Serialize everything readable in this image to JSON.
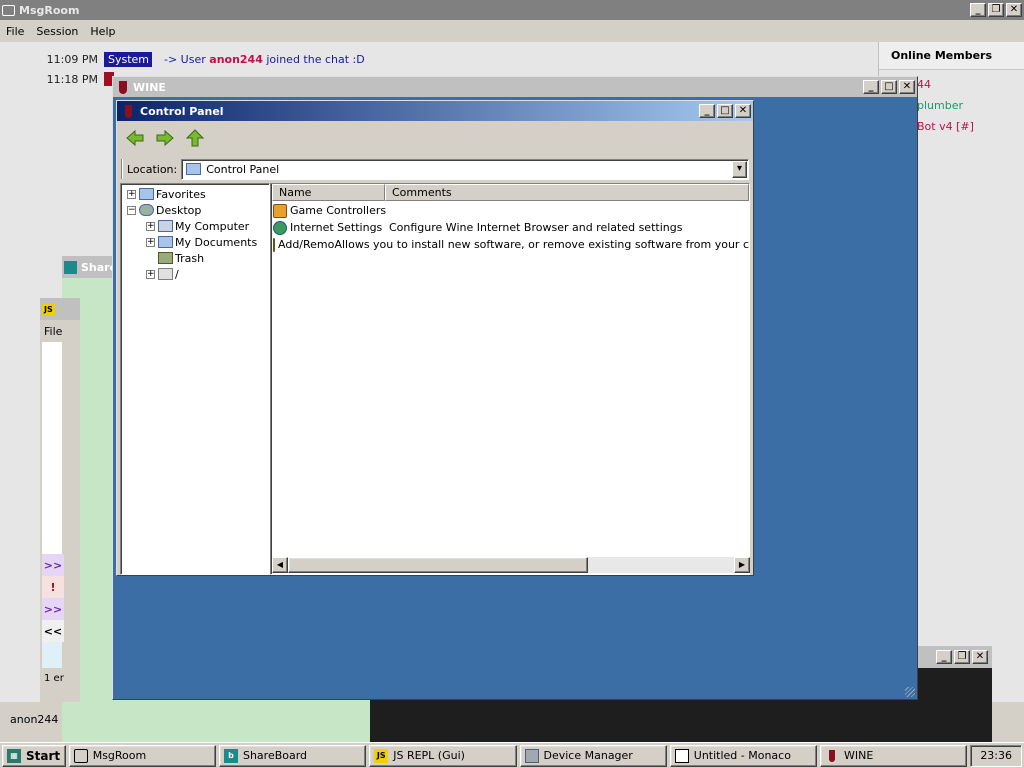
{
  "msgroom": {
    "title": "MsgRoom",
    "menu": [
      "File",
      "Session",
      "Help"
    ],
    "messages": [
      {
        "time": "11:09 PM",
        "sender": "System",
        "pre": "-> User ",
        "user": "anon244",
        "post": " joined the chat :D"
      },
      {
        "time": "11:18 PM"
      }
    ],
    "members_header": "Online Members",
    "members": [
      "44",
      "plumber",
      "Bot v4 [#]"
    ],
    "nick": "anon244"
  },
  "shareboard": {
    "title": "Share"
  },
  "jsrepl": {
    "icon": "JS",
    "menu": "File",
    "side_buttons": [
      ">>",
      "!",
      ">>",
      "<<"
    ],
    "status": "1 er"
  },
  "wine": {
    "title": "WINE"
  },
  "control_panel": {
    "title": "Control Panel",
    "location_label": "Location:",
    "location_value": "Control Panel",
    "tree": {
      "favorites": "Favorites",
      "desktop": "Desktop",
      "my_computer": "My Computer",
      "my_documents": "My Documents",
      "trash": "Trash",
      "root": "/"
    },
    "columns": {
      "name": "Name",
      "comments": "Comments"
    },
    "items": [
      {
        "name": "Game Controllers",
        "comment": ""
      },
      {
        "name": "Internet Settings",
        "comment": "Configure Wine Internet Browser and related settings"
      },
      {
        "name": "Add/Remove Pro...",
        "comment": "Allows you to install new software, or remove existing software from your c"
      }
    ]
  },
  "taskbar": {
    "start": "Start",
    "tasks": [
      "MsgRoom",
      "ShareBoard",
      "JS REPL (Gui)",
      "Device Manager",
      "Untitled - Monaco",
      "WINE"
    ],
    "clock": "23:36"
  },
  "colors": {
    "wine_desktop": "#3a6ea5",
    "titlebar_active": "#0a246a",
    "system_badge": "#1a1a9a",
    "username": "#c0104a"
  }
}
